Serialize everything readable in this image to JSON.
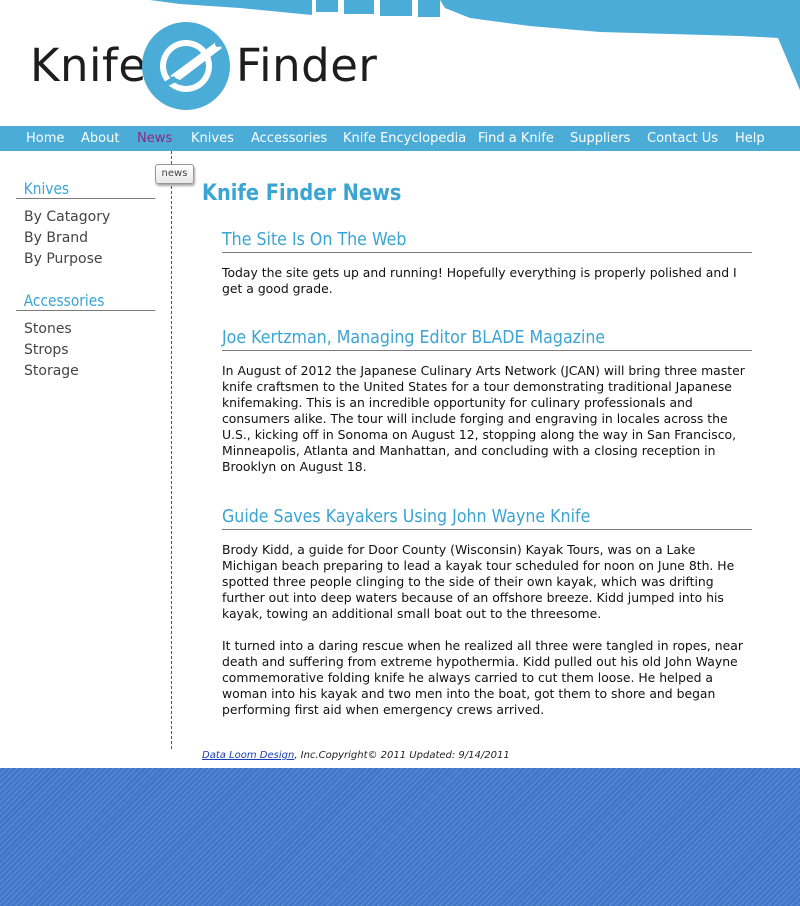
{
  "brand": {
    "name_part1": "Knife",
    "name_part2": "Finder",
    "accent_color": "#4aacd7"
  },
  "nav": {
    "items": [
      {
        "label": "Home",
        "active": false
      },
      {
        "label": "About",
        "active": false
      },
      {
        "label": "News",
        "active": true
      },
      {
        "label": "Knives",
        "active": false
      },
      {
        "label": "Accessories",
        "active": false
      },
      {
        "label": "Knife Encyclopedia",
        "active": false
      },
      {
        "label": "Find a Knife",
        "active": false
      },
      {
        "label": "Suppliers",
        "active": false
      },
      {
        "label": "Contact Us",
        "active": false
      },
      {
        "label": "Help",
        "active": false
      }
    ]
  },
  "sidebar": {
    "sections": [
      {
        "heading": "Knives",
        "items": [
          "By Catagory",
          "By Brand",
          "By Purpose"
        ]
      },
      {
        "heading": "Accessories",
        "items": [
          "Stones",
          "Strops",
          "Storage"
        ]
      }
    ]
  },
  "tab_label": "news",
  "main": {
    "title": "Knife Finder News",
    "articles": [
      {
        "title": "The Site Is On The Web",
        "paragraphs": [
          "Today the site gets up and running! Hopefully everything is properly polished and I get a good grade."
        ]
      },
      {
        "title": "Joe Kertzman, Managing Editor BLADE Magazine",
        "paragraphs": [
          "In August of 2012 the Japanese Culinary Arts Network (JCAN) will bring three master knife craftsmen to the United States for a tour demonstrating traditional Japanese knifemaking. This is an incredible opportunity for culinary professionals and consumers alike. The tour will include forging and engraving in locales across the U.S., kicking off in Sonoma on August 12, stopping along the way in San Francisco, Minneapolis, Atlanta and Manhattan, and concluding with a closing reception in Brooklyn on August 18."
        ]
      },
      {
        "title": "Guide Saves Kayakers Using John Wayne Knife",
        "paragraphs": [
          "Brody Kidd, a guide for Door County (Wisconsin) Kayak Tours, was on a Lake Michigan beach preparing to lead a kayak tour scheduled for noon on June 8th. He spotted three people clinging to the side of their own kayak, which was drifting further out into deep waters because of an offshore breeze. Kidd jumped into his kayak, towing an additional small boat out to the threesome.",
          "It turned into a daring rescue when he realized all three were tangled in ropes, near death and suffering from extreme hypothermia. Kidd pulled out his old John Wayne commemorative folding knife he always carried to cut them loose. He helped a woman into his kayak and two men into the boat, got them to shore and began performing first aid when emergency crews arrived."
        ]
      }
    ]
  },
  "footer": {
    "link_text": "Data Loom Design",
    "rest_text": ", Inc.Copyright© 2011 Updated: 9/14/2011"
  }
}
